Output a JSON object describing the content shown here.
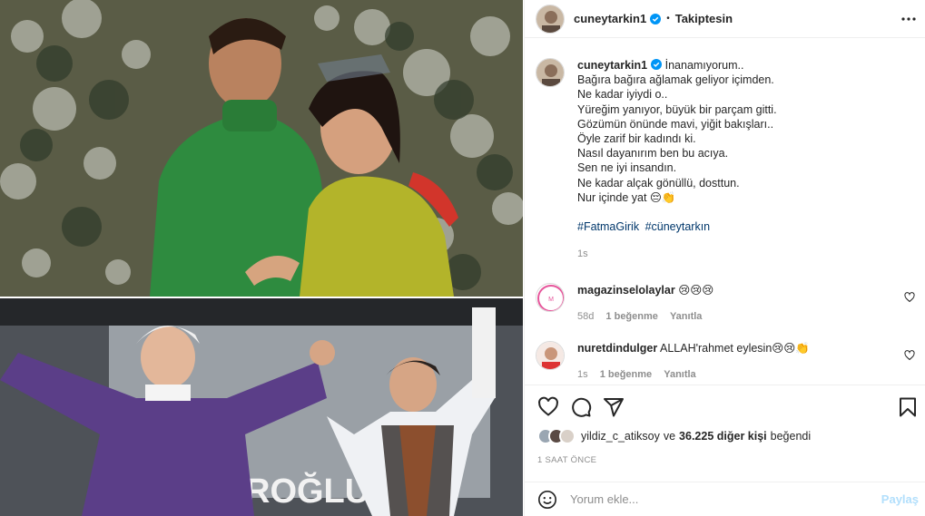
{
  "post": {
    "username": "cuneytarkin1",
    "follow_state": "Takiptesin",
    "caption_lines": [
      "İnanamıyorum..",
      "Bağıra bağıra ağlamak geliyor içimden.",
      "Ne kadar iyiydi o..",
      "Yüreğim yanıyor, büyük bir parçam gitti.",
      "Gözümün önünde mavi, yiğit bakışları..",
      "Öyle zarif bir kadındı ki.",
      "Nasıl dayanırım ben bu acıya.",
      "Sen ne iyi insandın.",
      "Ne kadar alçak gönüllü, dosttun.",
      "Nur içinde yat 😔👏"
    ],
    "hashtags": [
      "#FatmaGirik",
      "#cüneytarkın"
    ],
    "caption_time": "1s",
    "photo_top_sign": "",
    "photo_bottom_sign": "ROĞLU"
  },
  "comments": [
    {
      "username": "magazinselolaylar",
      "text": "😢😢😢",
      "time": "58d",
      "likes": "1 beğenme",
      "reply": "Yanıtla"
    },
    {
      "username": "nuretdindulger",
      "text": "ALLAH'rahmet eylesin😢😢👏",
      "time": "1s",
      "likes": "1 beğenme",
      "reply": "Yanıtla"
    }
  ],
  "likes_line": {
    "user": "yildiz_c_atiksoy",
    "connector": "ve",
    "count": "36.225 diğer kişi",
    "suffix": "beğendi"
  },
  "posted_ago": "1 SAAT ÖNCE",
  "comment_box": {
    "placeholder": "Yorum ekle...",
    "submit": "Paylaş"
  },
  "colors": {
    "text": "#262626",
    "muted": "#8e8e8e",
    "link": "#00376b",
    "verified": "#0095f6",
    "submit_disabled": "#b2dffc"
  }
}
